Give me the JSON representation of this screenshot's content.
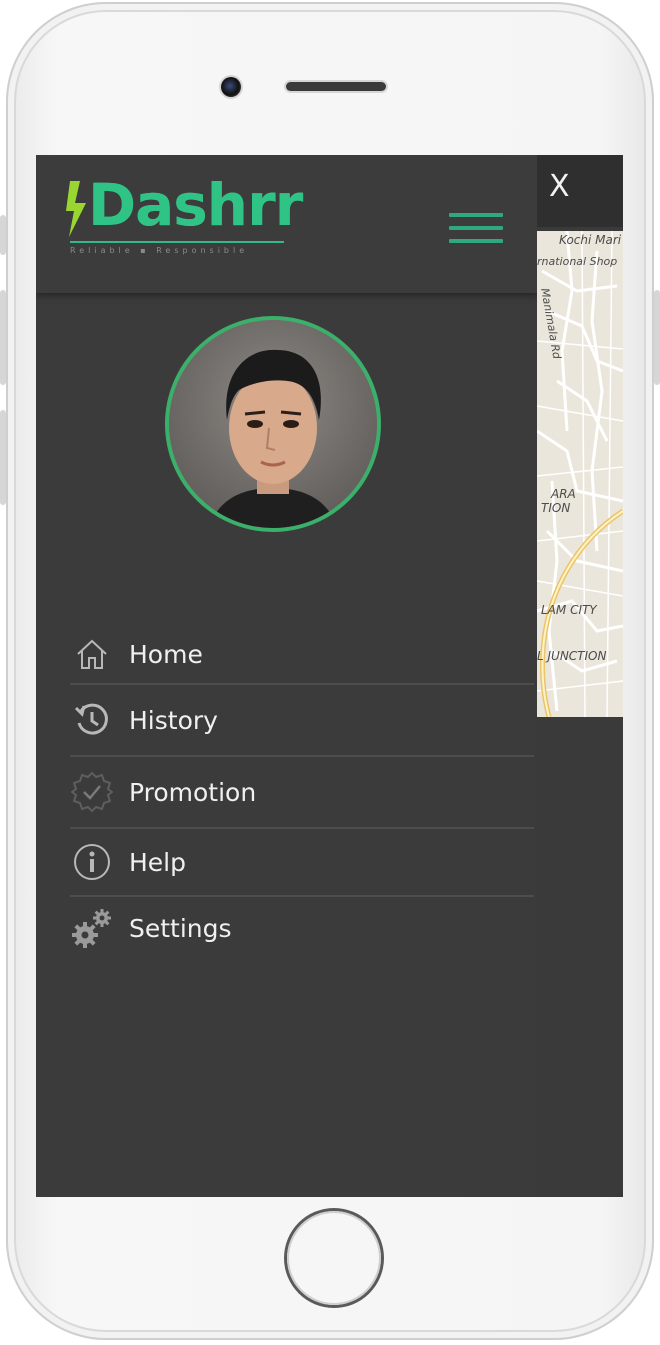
{
  "app": {
    "logo_text": "Dashrr",
    "tagline": "Reliable ▪ Responsible"
  },
  "menu": {
    "items": [
      {
        "label": "Home",
        "icon": "home-icon"
      },
      {
        "label": "History",
        "icon": "history-icon"
      },
      {
        "label": "Promotion",
        "icon": "promotion-badge-icon"
      },
      {
        "label": "Help",
        "icon": "info-icon"
      },
      {
        "label": "Settings",
        "icon": "gears-icon"
      }
    ]
  },
  "close_label": "X",
  "map": {
    "labels": [
      "Kochi Mari",
      "rnational Shop",
      "Manimala Rd",
      "ARA",
      "TION",
      "LAM CITY",
      "L JUNCTION"
    ]
  },
  "colors": {
    "accent": "#2fc486",
    "drawer_bg": "#3b3b3b",
    "avatar_border": "#3bb06b"
  }
}
